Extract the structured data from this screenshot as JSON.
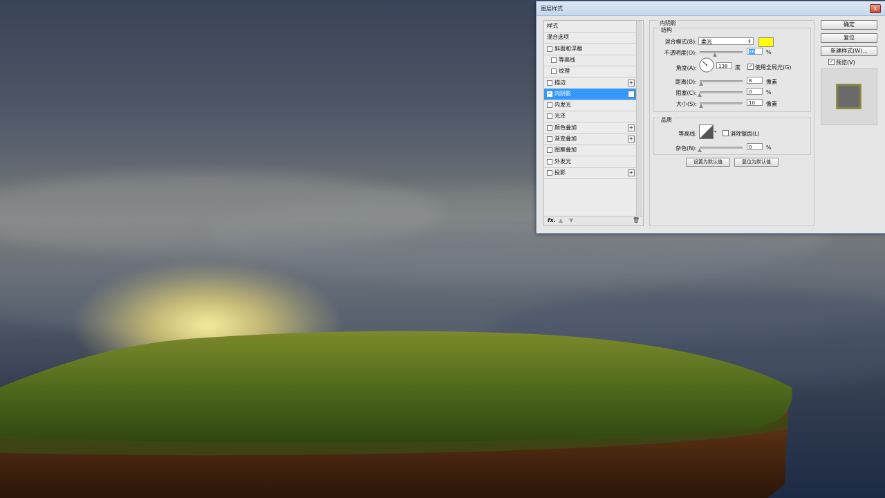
{
  "dialog": {
    "title": "图层样式",
    "close_label": "x"
  },
  "styles_list": {
    "items": [
      {
        "label": "样式",
        "checkbox": false,
        "plus": false,
        "indent": 0,
        "selected": false
      },
      {
        "label": "混合选项",
        "checkbox": false,
        "plus": false,
        "indent": 0,
        "selected": false
      },
      {
        "label": "斜面和浮雕",
        "checkbox": true,
        "checked": false,
        "plus": false,
        "indent": 0,
        "selected": false
      },
      {
        "label": "等高线",
        "checkbox": true,
        "checked": false,
        "plus": false,
        "indent": 1,
        "selected": false
      },
      {
        "label": "纹理",
        "checkbox": true,
        "checked": false,
        "plus": false,
        "indent": 1,
        "selected": false
      },
      {
        "label": "描边",
        "checkbox": true,
        "checked": false,
        "plus": true,
        "indent": 0,
        "selected": false
      },
      {
        "label": "内阴影",
        "checkbox": true,
        "checked": true,
        "plus": true,
        "indent": 0,
        "selected": true
      },
      {
        "label": "内发光",
        "checkbox": true,
        "checked": false,
        "plus": false,
        "indent": 0,
        "selected": false
      },
      {
        "label": "光泽",
        "checkbox": true,
        "checked": false,
        "plus": false,
        "indent": 0,
        "selected": false
      },
      {
        "label": "颜色叠加",
        "checkbox": true,
        "checked": false,
        "plus": true,
        "indent": 0,
        "selected": false
      },
      {
        "label": "渐变叠加",
        "checkbox": true,
        "checked": false,
        "plus": true,
        "indent": 0,
        "selected": false
      },
      {
        "label": "图案叠加",
        "checkbox": true,
        "checked": false,
        "plus": false,
        "indent": 0,
        "selected": false
      },
      {
        "label": "外发光",
        "checkbox": true,
        "checked": false,
        "plus": false,
        "indent": 0,
        "selected": false
      },
      {
        "label": "投影",
        "checkbox": true,
        "checked": false,
        "plus": true,
        "indent": 0,
        "selected": false
      }
    ],
    "footer": {
      "fx": "fx.",
      "up_icon": "arrow-up-icon",
      "down_icon": "arrow-down-icon",
      "trash_icon": "trash-icon"
    }
  },
  "inner_shadow": {
    "section_title": "内阴影",
    "structure": {
      "title": "结构",
      "blend_mode_label": "混合模式(B):",
      "blend_mode_value": "柔光",
      "color": "#ffff00",
      "opacity_label": "不透明度(O):",
      "opacity_value": "36",
      "opacity_fraction": 0.36,
      "opacity_unit": "%",
      "angle_label": "角度(A):",
      "angle_value": "138",
      "angle_unit": "度",
      "global_light_label": "使用全局光(G)",
      "global_light_checked": true,
      "distance_label": "距离(D):",
      "distance_value": "8",
      "distance_fraction": 0.03,
      "distance_unit": "像素",
      "choke_label": "阻塞(C):",
      "choke_value": "0",
      "choke_fraction": 0.0,
      "choke_unit": "%",
      "size_label": "大小(S):",
      "size_value": "10",
      "size_fraction": 0.04,
      "size_unit": "像素"
    },
    "quality": {
      "title": "品质",
      "contour_label": "等高线:",
      "antialias_label": "消除锯齿(L)",
      "antialias_checked": false,
      "noise_label": "杂色(N):",
      "noise_value": "0",
      "noise_fraction": 0.0,
      "noise_unit": "%"
    },
    "set_default_label": "设置为默认值",
    "reset_default_label": "复位为默认值"
  },
  "buttons": {
    "ok": "确定",
    "reset": "复位",
    "new_style": "新建样式(W)...",
    "preview_label": "预览(V)",
    "preview_checked": true
  },
  "overlay_annotation": "ffff00",
  "colors": {
    "selection": "#3399ff",
    "annotation": "#e8130e",
    "swatch": "#ffff00"
  }
}
